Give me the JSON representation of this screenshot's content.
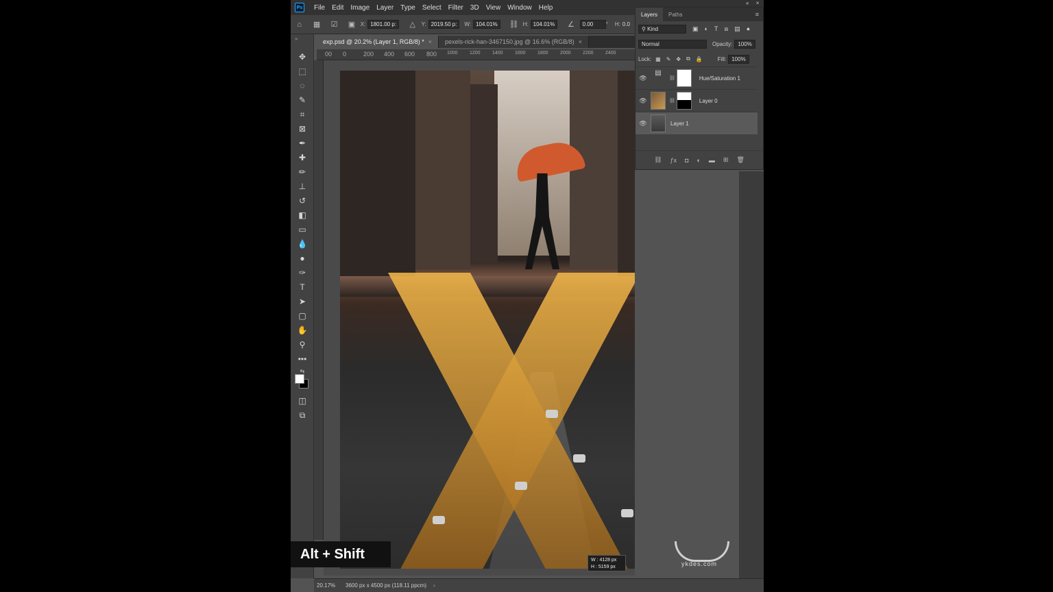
{
  "menubar": {
    "logo": "Ps",
    "items": [
      "File",
      "Edit",
      "Image",
      "Layer",
      "Type",
      "Select",
      "Filter",
      "3D",
      "View",
      "Window",
      "Help"
    ]
  },
  "options": {
    "x_label": "X:",
    "x_value": "1801.00 p:",
    "y_label": "Y:",
    "y_value": "2019.50 p:",
    "w_label": "W:",
    "w_value": "104.01%",
    "h_label": "H:",
    "h_value": "104.01%",
    "angle_value": "0.00",
    "angle_unit": "°",
    "h2_label": "H:",
    "h2_value": "0.0"
  },
  "tabs": [
    {
      "label": "exp.psd @ 20.2% (Layer 1, RGB/8) *",
      "close": "×"
    },
    {
      "label": "pexels-rick-han-3467150.jpg @ 16.6% (RGB/8)",
      "close": "×"
    }
  ],
  "ruler_top": [
    "00",
    "0",
    "200",
    "400",
    "600",
    "800",
    "1000",
    "1200",
    "1400",
    "1600",
    "1800",
    "2000",
    "2200",
    "2400"
  ],
  "layers_panel": {
    "tab_layers": "Layers",
    "tab_paths": "Paths",
    "kind_label": "Kind",
    "blend_mode": "Normal",
    "opacity_label": "Opacity:",
    "opacity_value": "100%",
    "lock_label": "Lock:",
    "fill_label": "Fill:",
    "fill_value": "100%",
    "layers": [
      {
        "name": "Hue/Saturation 1"
      },
      {
        "name": "Layer 0"
      },
      {
        "name": "Layer 1"
      }
    ]
  },
  "transform_tip": {
    "w": "W : 4128 px",
    "h": "H : 5159 px"
  },
  "status": {
    "zoom": "20.17%",
    "doc_info": "3600 px x 4500 px (118.11 ppcm)",
    "arrow": "›"
  },
  "shortcut_overlay": "Alt + Shift",
  "watermark": "ykdes.com",
  "colors": {
    "accent": "#31a8ff",
    "umbrella": "#d05a2e",
    "stripe": "#ecb248"
  }
}
